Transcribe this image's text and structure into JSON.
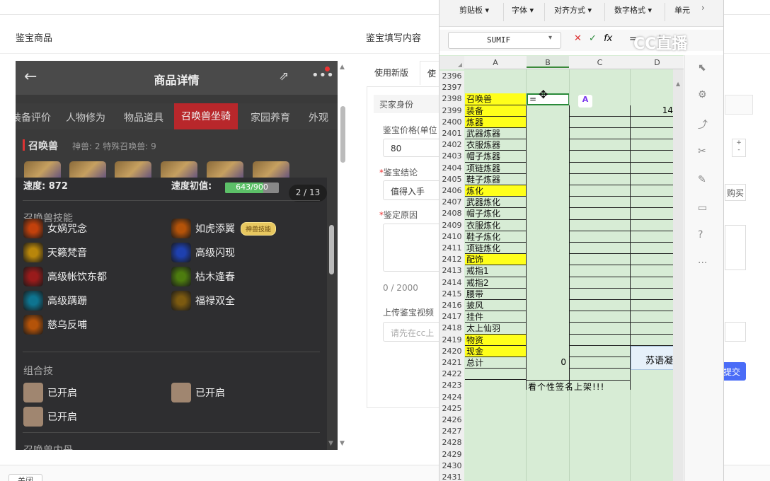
{
  "page": {
    "left_title": "鉴宝商品",
    "mid_title": "鉴宝填写内容",
    "tabs": [
      "使用新版",
      "使"
    ],
    "buyer_label": "买家身份",
    "price_label": "鉴宝价格(单位",
    "price_value": "80",
    "conclusion_label": "鉴宝结论",
    "conclusion_value": "值得入手",
    "reason_label": "鉴定原因",
    "char_count": "0 / 2000",
    "upload_label": "上传鉴宝视频",
    "upload_placeholder": "请先在cc上",
    "buy_text": "购买",
    "submit_label": "提交",
    "close_label": "关闭",
    "watermark": "CC直播"
  },
  "phone": {
    "title": "商品详情",
    "tabs": [
      "装备评价",
      "人物修为",
      "物品道具",
      "召唤兽坐骑",
      "家园养育",
      "外观"
    ],
    "active_tab": "召唤兽坐骑",
    "section_title": "召唤兽",
    "section_sub": "神兽: 2   特殊召唤兽: 9",
    "popup": {
      "speed_label": "速度: 872",
      "init_speed_label": "速度初值:",
      "init_speed_value": "643/900",
      "init_speed_fraction": 0.714,
      "pager": "2 / 13",
      "skills_title": "召唤兽技能",
      "skills": [
        {
          "name": "女娲咒念",
          "icon": "nuwa-icon",
          "color": "#c2410c"
        },
        {
          "name": "如虎添翼",
          "icon": "tiger-wing-icon",
          "color": "#b45309",
          "badge": "神兽技能"
        },
        {
          "name": "天籁梵音",
          "icon": "heaven-sound-icon",
          "color": "#b8860b"
        },
        {
          "name": "高级闪现",
          "icon": "flash-icon",
          "color": "#1e40af"
        },
        {
          "name": "高级帐饮东都",
          "icon": "banquet-icon",
          "color": "#991b1b"
        },
        {
          "name": "枯木逢春",
          "icon": "spring-icon",
          "color": "#4d7c0f"
        },
        {
          "name": "高级蹒跚",
          "icon": "stagger-icon",
          "color": "#0e7490"
        },
        {
          "name": "福禄双全",
          "icon": "fortune-icon",
          "color": "#7c5a10"
        },
        {
          "name": "慈乌反哺",
          "icon": "crow-icon",
          "color": "#b45309"
        }
      ],
      "combo_title": "组合技",
      "combos": [
        "已开启",
        "已开启",
        "已开启"
      ],
      "more_title": "召唤兽内丹"
    }
  },
  "excel": {
    "ribbon": [
      "剪贴板",
      "字体",
      "对齐方式",
      "数字格式",
      "单元"
    ],
    "namebox": "SUMIF",
    "formula": "=",
    "columns": [
      "A",
      "B",
      "C",
      "D"
    ],
    "rows": [
      {
        "n": "2396",
        "a": ""
      },
      {
        "n": "2397",
        "a": ""
      },
      {
        "n": "2398",
        "a": "召唤兽",
        "y": true,
        "b": "="
      },
      {
        "n": "2399",
        "a": "装备",
        "y": true,
        "d": "14"
      },
      {
        "n": "2400",
        "a": "炼器",
        "y": true
      },
      {
        "n": "2401",
        "a": "武器炼器"
      },
      {
        "n": "2402",
        "a": "衣服炼器"
      },
      {
        "n": "2403",
        "a": "帽子炼器"
      },
      {
        "n": "2404",
        "a": "项链炼器"
      },
      {
        "n": "2405",
        "a": "鞋子炼器"
      },
      {
        "n": "2406",
        "a": "炼化",
        "y": true
      },
      {
        "n": "2407",
        "a": "武器炼化"
      },
      {
        "n": "2408",
        "a": "帽子炼化"
      },
      {
        "n": "2409",
        "a": "衣服炼化"
      },
      {
        "n": "2410",
        "a": "鞋子炼化"
      },
      {
        "n": "2411",
        "a": "项链炼化"
      },
      {
        "n": "2412",
        "a": "配饰",
        "y": true
      },
      {
        "n": "2413",
        "a": "戒指1"
      },
      {
        "n": "2414",
        "a": "戒指2"
      },
      {
        "n": "2415",
        "a": "腰带"
      },
      {
        "n": "2416",
        "a": "披风"
      },
      {
        "n": "2417",
        "a": "挂件"
      },
      {
        "n": "2418",
        "a": "太上仙羽"
      },
      {
        "n": "2419",
        "a": "物资",
        "y": true
      },
      {
        "n": "2420",
        "a": "现金",
        "y": true
      },
      {
        "n": "2421",
        "a": "总计",
        "b": "0",
        "d": "苏语凝"
      },
      {
        "n": "2422",
        "a": ""
      },
      {
        "n": "2423",
        "a": "",
        "b": "看个性签名上架!!!"
      },
      {
        "n": "2424",
        "a": ""
      },
      {
        "n": "2425",
        "a": ""
      },
      {
        "n": "2426",
        "a": ""
      },
      {
        "n": "2427",
        "a": ""
      },
      {
        "n": "2428",
        "a": ""
      },
      {
        "n": "2429",
        "a": ""
      },
      {
        "n": "2430",
        "a": ""
      },
      {
        "n": "2431",
        "a": ""
      }
    ]
  }
}
